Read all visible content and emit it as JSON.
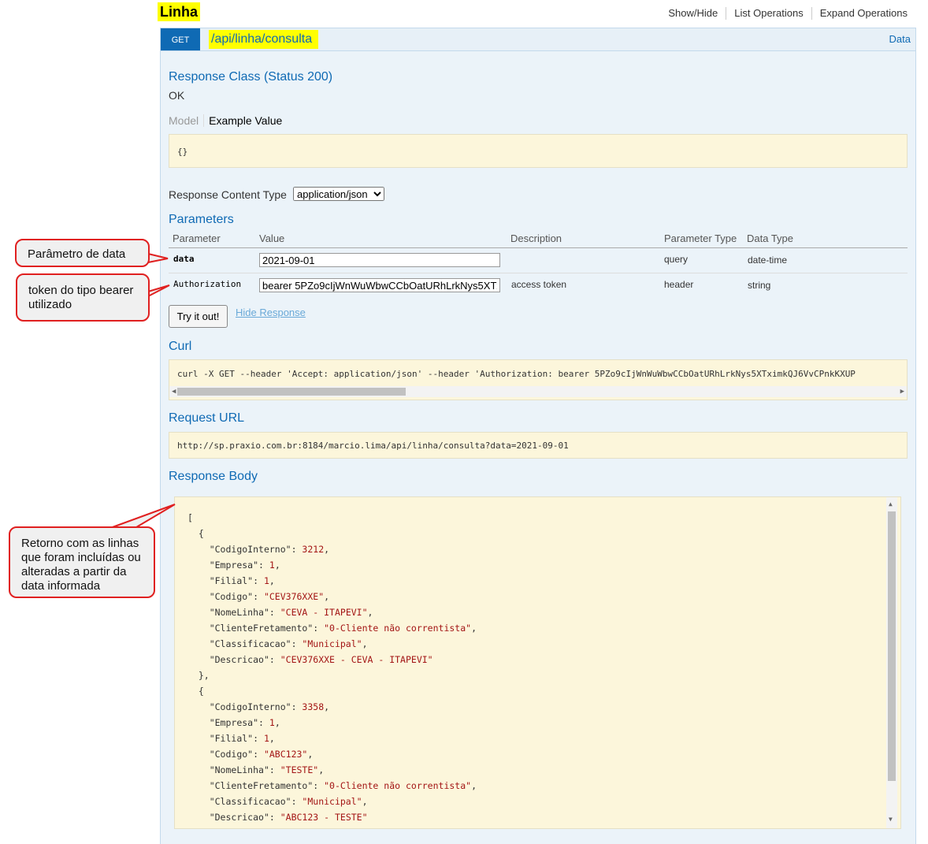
{
  "section": {
    "title": "Linha",
    "links": [
      "Show/Hide",
      "List Operations",
      "Expand Operations"
    ]
  },
  "operation": {
    "method": "GET",
    "path": "/api/linha/consulta",
    "summary": "Data"
  },
  "response_class": {
    "heading": "Response Class (Status 200)",
    "status_text": "OK",
    "tab_model": "Model",
    "tab_example": "Example Value",
    "example": "{}"
  },
  "content_type": {
    "label": "Response Content Type",
    "selected": "application/json"
  },
  "parameters": {
    "heading": "Parameters",
    "columns": [
      "Parameter",
      "Value",
      "Description",
      "Parameter Type",
      "Data Type"
    ],
    "rows": [
      {
        "name": "data",
        "value": "2021-09-01",
        "description": "",
        "param_type": "query",
        "data_type": "date-time"
      },
      {
        "name": "Authorization",
        "value": "bearer 5PZo9cIjWnWuWbwCCbOatURhLrkNys5XTximkQJ6VvCPnkKXUP",
        "description": "access token",
        "param_type": "header",
        "data_type": "string"
      }
    ]
  },
  "buttons": {
    "try_it": "Try it out!",
    "hide_response": "Hide Response"
  },
  "curl": {
    "heading": "Curl",
    "command": "curl -X GET --header 'Accept: application/json' --header 'Authorization: bearer 5PZo9cIjWnWuWbwCCbOatURhLrkNys5XTximkQJ6VvCPnkKXUP"
  },
  "request_url": {
    "heading": "Request URL",
    "url": "http://sp.praxio.com.br:8184/marcio.lima/api/linha/consulta?data=2021-09-01"
  },
  "response_body": {
    "heading": "Response Body",
    "items": [
      {
        "CodigoInterno": 3212,
        "Empresa": 1,
        "Filial": 1,
        "Codigo": "CEV376XXE",
        "NomeLinha": "CEVA - ITAPEVI",
        "ClienteFretamento": "0-Cliente não correntista",
        "Classificacao": "Municipal",
        "Descricao": "CEV376XXE - CEVA - ITAPEVI"
      },
      {
        "CodigoInterno": 3358,
        "Empresa": 1,
        "Filial": 1,
        "Codigo": "ABC123",
        "NomeLinha": "TESTE",
        "ClienteFretamento": "0-Cliente não correntista",
        "Classificacao": "Municipal",
        "Descricao": "ABC123 - TESTE"
      }
    ]
  },
  "callouts": {
    "date_param": "Parâmetro de data",
    "token": "token do tipo bearer utilizado",
    "response": "Retorno com as linhas que foram incluídas ou alteradas a partir da data informada"
  }
}
